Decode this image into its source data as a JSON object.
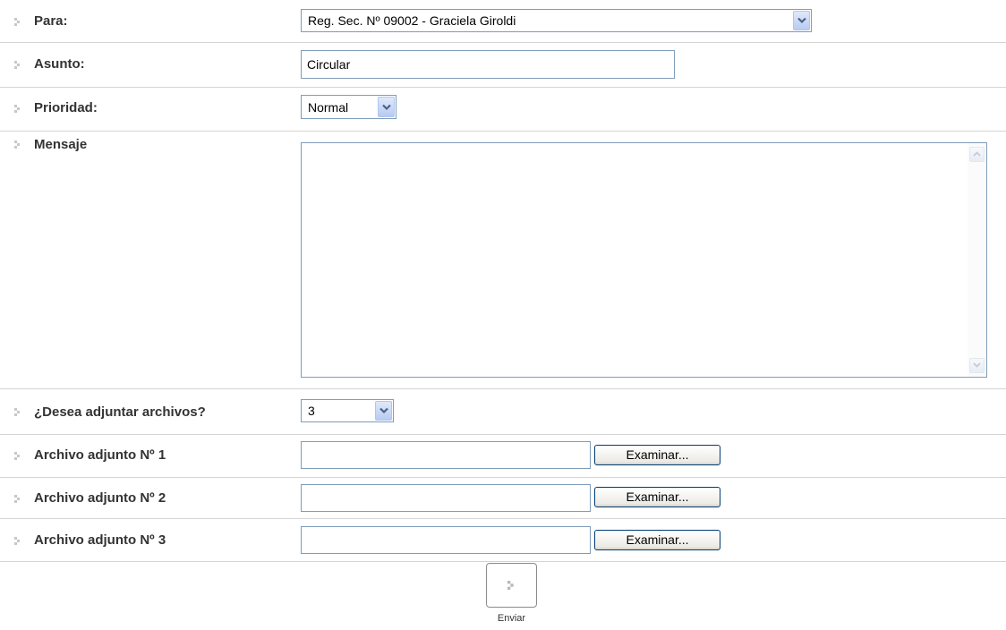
{
  "form": {
    "para": {
      "label": "Para:",
      "value": "Reg. Sec. Nº 09002 - Graciela Giroldi"
    },
    "asunto": {
      "label": "Asunto:",
      "value": "Circular"
    },
    "prioridad": {
      "label": "Prioridad:",
      "value": "Normal"
    },
    "mensaje": {
      "label": "Mensaje",
      "value": ""
    },
    "adjuntar": {
      "label": "¿Desea adjuntar archivos?",
      "value": "3"
    },
    "adjuntos": [
      {
        "label": "Archivo adjunto Nº 1",
        "value": "",
        "button": "Examinar..."
      },
      {
        "label": "Archivo adjunto Nº 2",
        "value": "",
        "button": "Examinar..."
      },
      {
        "label": "Archivo adjunto Nº 3",
        "value": "",
        "button": "Examinar..."
      }
    ],
    "submit": {
      "label": "Enviar"
    }
  },
  "colors": {
    "field_border": "#7f9db9",
    "row_divider": "#d4d4d4",
    "label_text": "#333333"
  }
}
